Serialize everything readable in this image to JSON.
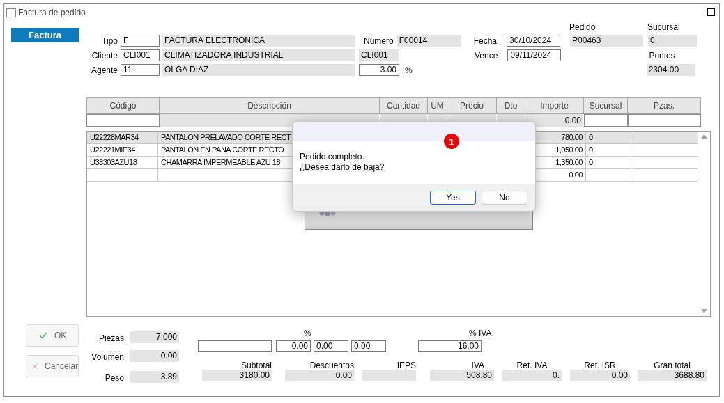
{
  "window": {
    "title": "Factura de pedido"
  },
  "header": {
    "tab": "Factura",
    "tipo": {
      "label": "Tipo",
      "code": "F",
      "name": "FACTURA ELECTRONICA"
    },
    "cliente": {
      "label": "Cliente",
      "code": "CLI001",
      "name": "CLIMATIZADORA INDUSTRIAL",
      "ref": "CLI001"
    },
    "agente": {
      "label": "Agente",
      "code": "11",
      "name": "OLGA DIAZ",
      "commission": "3.00",
      "unit": "%"
    },
    "numero": {
      "label": "Número",
      "value": "F00014"
    },
    "fecha": {
      "label": "Fecha",
      "value": "30/10/2024"
    },
    "vence": {
      "label": "Vence",
      "value": "09/11/2024"
    },
    "pedido": {
      "label": "Pedido",
      "value": "P00463"
    },
    "sucursal": {
      "label": "Sucursal",
      "value": "0"
    },
    "puntos": {
      "label": "Puntos",
      "value": "2304.00"
    }
  },
  "table": {
    "columns": [
      "Código",
      "Descripción",
      "Cantidad",
      "UM",
      "Precio",
      "Dto",
      "Importe",
      "Sucursal",
      "Pzas."
    ],
    "entry": {
      "importe": "0.00"
    },
    "rows": [
      {
        "codigo": "U22228MAR34",
        "descripcion": "PANTALON PRELAVADO CORTE RECT",
        "importe": "780.00",
        "sucursal": "0",
        "selected": true
      },
      {
        "codigo": "U22221MIE34",
        "descripcion": "PANTALON EN PANA CORTE RECTO",
        "importe": "1,050.00",
        "sucursal": "0",
        "selected": false
      },
      {
        "codigo": "U33303AZU18",
        "descripcion": "CHAMARRA IMPERMEABLE AZU 18",
        "importe": "1,350.00",
        "sucursal": "0",
        "selected": false
      },
      {
        "importe": "0.00",
        "selected": false
      }
    ]
  },
  "actions": [
    {
      "label": "OK",
      "kind": "ok"
    },
    {
      "label": "Cancelar",
      "kind": "cancel"
    }
  ],
  "totals": {
    "measures": [
      {
        "label": "Piezas",
        "value": "7.000"
      },
      {
        "label": "Volumen",
        "value": "0.00"
      },
      {
        "label": "Peso",
        "value": "3.89"
      }
    ],
    "discount_label": "%",
    "discounts": [
      "0.00",
      "0.00",
      "0.00"
    ],
    "iva_rate": {
      "label": "% IVA",
      "value": "16.00"
    },
    "amounts": [
      {
        "label": "Subtotal",
        "value": "3180.00"
      },
      {
        "label": "Descuentos",
        "value": "0.00"
      },
      {
        "label": "IEPS"
      },
      {
        "label": "IVA",
        "value": "508.80"
      },
      {
        "label": "Ret. IVA",
        "value": "0."
      },
      {
        "label": "Ret. ISR",
        "value": "0.00"
      },
      {
        "label": "Gran total",
        "value": "3688.80"
      }
    ]
  },
  "dialog": {
    "badge": "1",
    "message": [
      "Pedido completo.",
      "¿Desea darlo de baja?"
    ],
    "buttons": [
      {
        "label": "Yes",
        "selected": true
      },
      {
        "label": "No",
        "selected": false
      }
    ]
  }
}
